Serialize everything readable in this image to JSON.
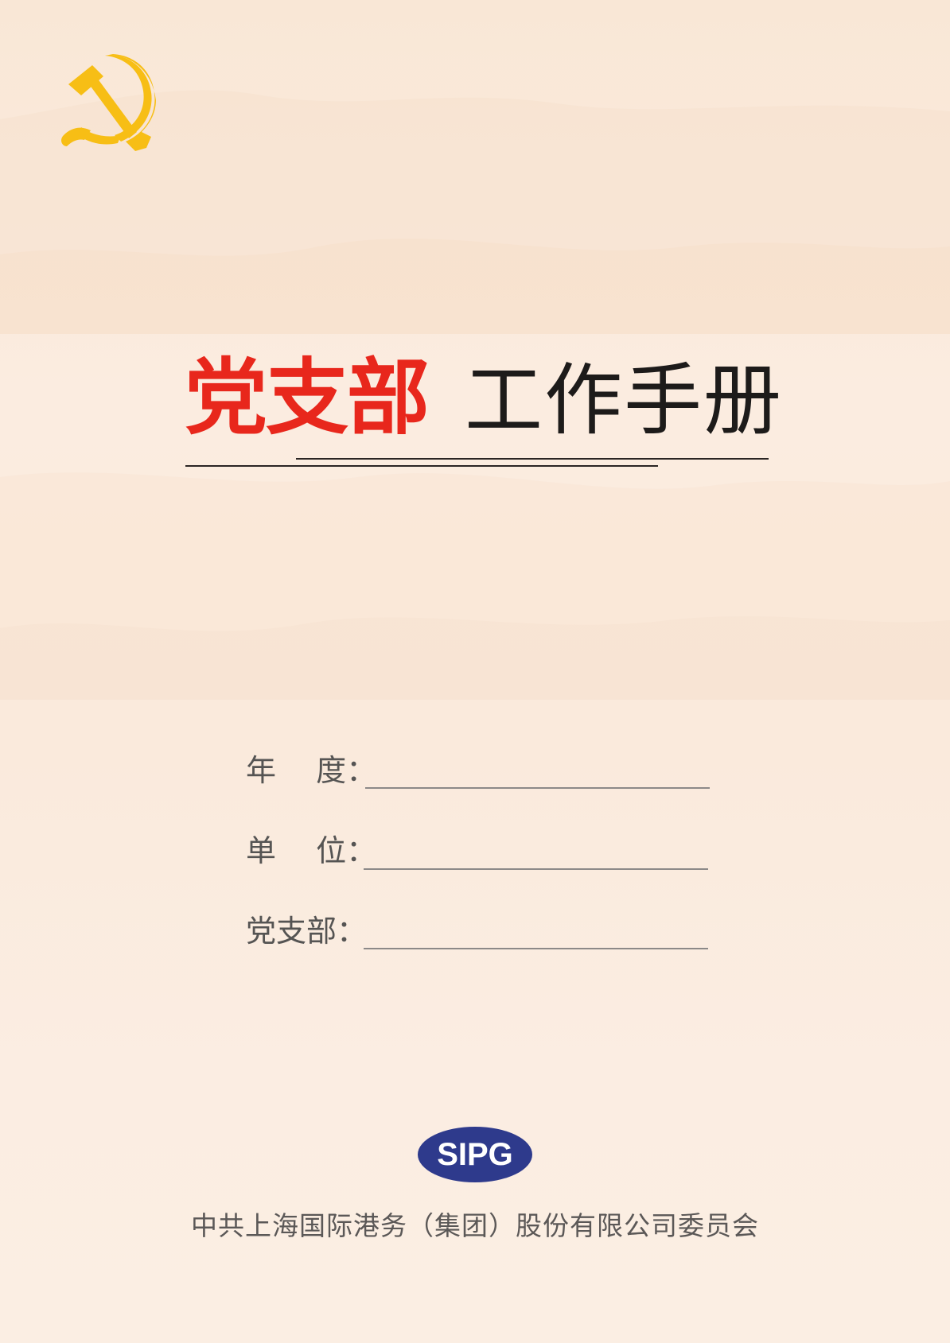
{
  "colors": {
    "title_red": "#e8271c",
    "emblem_yellow": "#f7be15",
    "logo_navy": "#2e3a8c"
  },
  "emblem": {
    "icon": "hammer-sickle-icon"
  },
  "title": {
    "red_part": "党支部",
    "black_part": "工作手册"
  },
  "fields": [
    {
      "label": "年　 度："
    },
    {
      "label": "单　 位："
    },
    {
      "label": "党支部："
    }
  ],
  "logo": {
    "text": "SIPG"
  },
  "footer": "中共上海国际港务（集团）股份有限公司委员会"
}
